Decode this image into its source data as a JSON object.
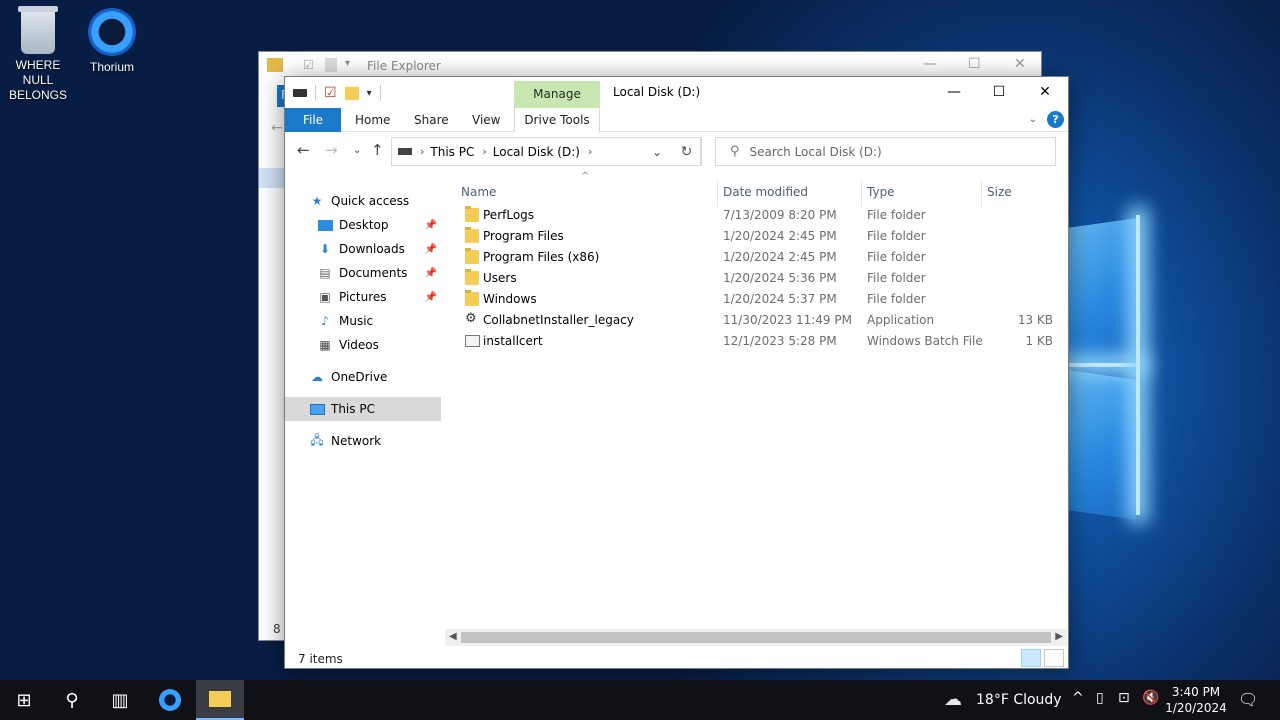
{
  "desktop": {
    "icons": [
      {
        "label": "WHERE NULL BELONGS",
        "icon": "recycle-bin-icon"
      },
      {
        "label": "Thorium",
        "icon": "thorium-browser-icon"
      }
    ]
  },
  "back_window": {
    "title": "File Explorer",
    "file_tab": "F",
    "status": "8 i"
  },
  "window": {
    "title": "Local Disk (D:)",
    "manage_tab": "Manage",
    "ribbon_tabs": {
      "file": "File",
      "home": "Home",
      "share": "Share",
      "view": "View",
      "drive_tools": "Drive Tools"
    },
    "help": "?",
    "address": {
      "this_pc": "This PC",
      "drive": "Local Disk (D:)"
    },
    "search_placeholder": "Search Local Disk (D:)",
    "nav": {
      "quick_access": "Quick access",
      "desktop": "Desktop",
      "downloads": "Downloads",
      "documents": "Documents",
      "pictures": "Pictures",
      "music": "Music",
      "videos": "Videos",
      "onedrive": "OneDrive",
      "this_pc": "This PC",
      "network": "Network"
    },
    "columns": {
      "name": "Name",
      "date": "Date modified",
      "type": "Type",
      "size": "Size"
    },
    "files": [
      {
        "name": "PerfLogs",
        "date": "7/13/2009 8:20 PM",
        "type": "File folder",
        "size": ""
      },
      {
        "name": "Program Files",
        "date": "1/20/2024 2:45 PM",
        "type": "File folder",
        "size": ""
      },
      {
        "name": "Program Files (x86)",
        "date": "1/20/2024 2:45 PM",
        "type": "File folder",
        "size": ""
      },
      {
        "name": "Users",
        "date": "1/20/2024 5:36 PM",
        "type": "File folder",
        "size": ""
      },
      {
        "name": "Windows",
        "date": "1/20/2024 5:37 PM",
        "type": "File folder",
        "size": ""
      },
      {
        "name": "CollabnetInstaller_legacy",
        "date": "11/30/2023 11:49 PM",
        "type": "Application",
        "size": "13 KB"
      },
      {
        "name": "installcert",
        "date": "12/1/2023 5:28 PM",
        "type": "Windows Batch File",
        "size": "1 KB"
      }
    ],
    "status_count": "7 items"
  },
  "taskbar": {
    "weather": "18°F  Cloudy",
    "time": "3:40 PM",
    "date": "1/20/2024"
  }
}
